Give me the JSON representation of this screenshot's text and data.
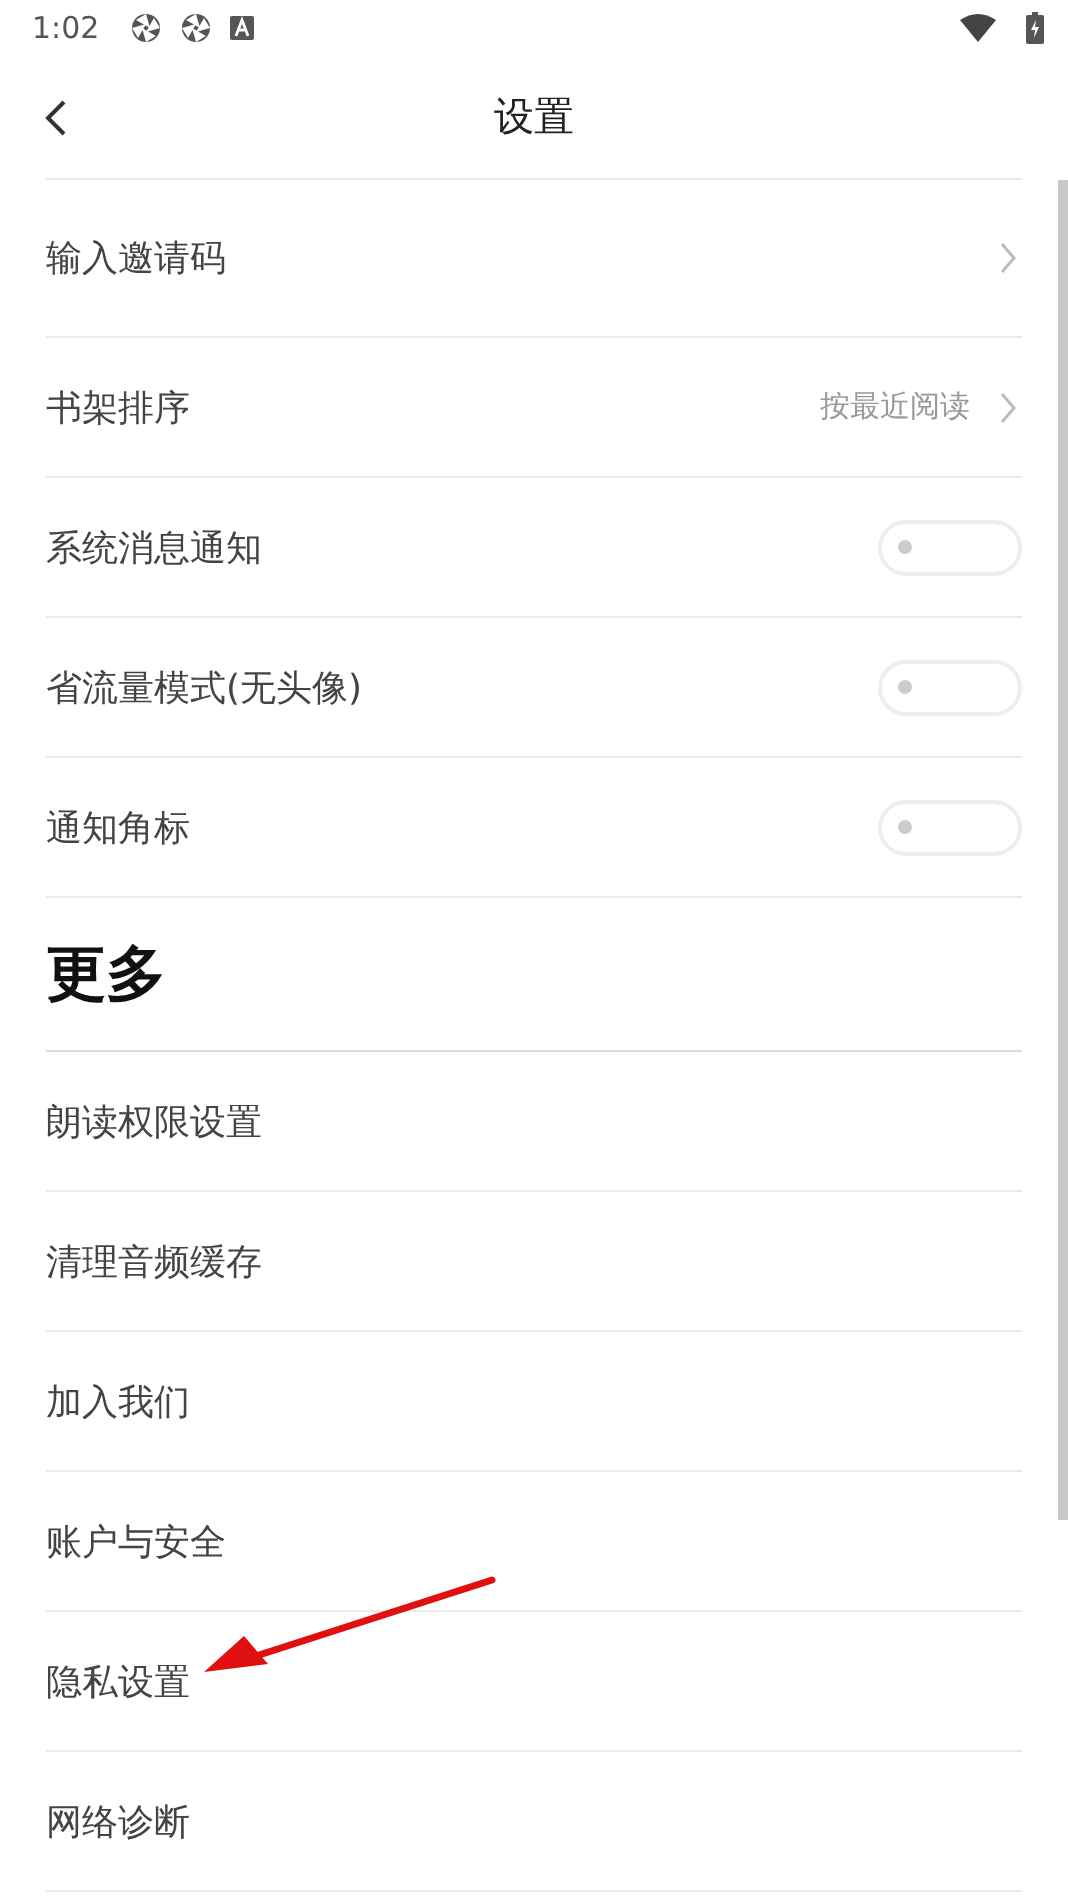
{
  "status_bar": {
    "time": "1:02"
  },
  "header": {
    "title": "设置"
  },
  "settings": [
    {
      "kind": "link",
      "label": "输入邀请码"
    },
    {
      "kind": "link",
      "label": "书架排序",
      "value": "按最近阅读"
    },
    {
      "kind": "toggle",
      "label": "系统消息通知",
      "on": false
    },
    {
      "kind": "toggle",
      "label": "省流量模式(无头像)",
      "on": false
    },
    {
      "kind": "toggle",
      "label": "通知角标",
      "on": false
    }
  ],
  "more": {
    "title": "更多",
    "items": [
      {
        "label": "朗读权限设置"
      },
      {
        "label": "清理音频缓存"
      },
      {
        "label": "加入我们"
      },
      {
        "label": "账户与安全"
      },
      {
        "label": "隐私设置"
      },
      {
        "label": "网络诊断"
      }
    ]
  }
}
